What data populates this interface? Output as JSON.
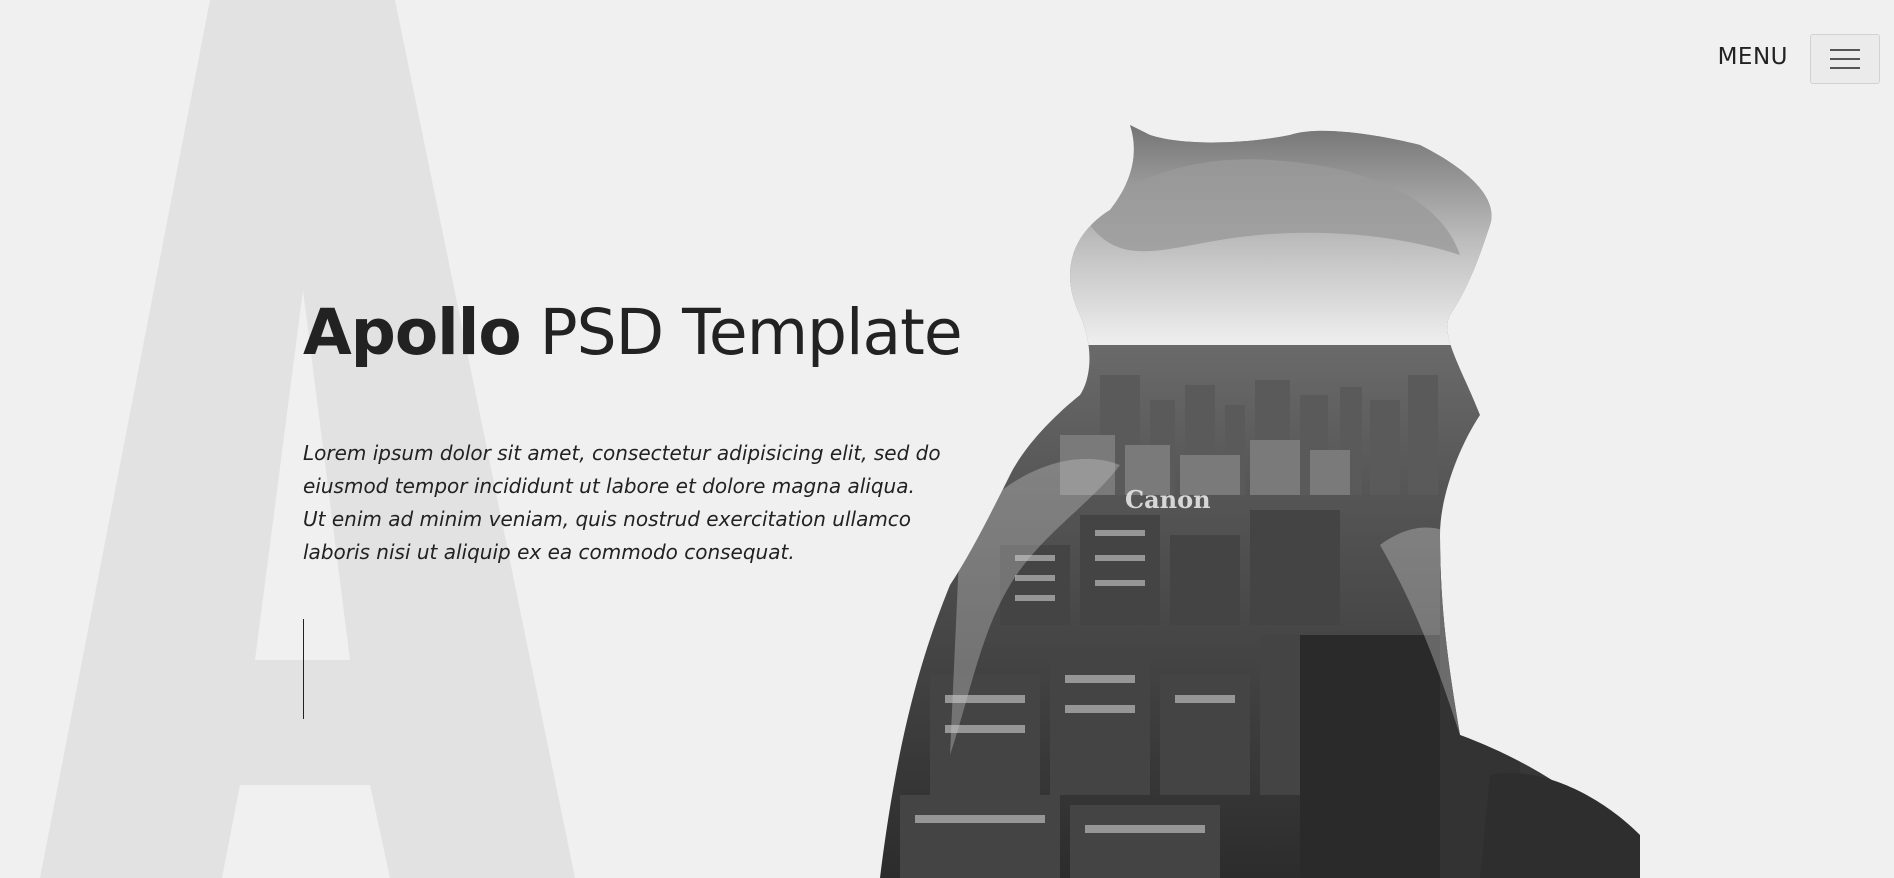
{
  "header": {
    "menu_label": "MENU"
  },
  "hero": {
    "background_letter": "A",
    "title_bold": "Apollo",
    "title_rest": " PSD Template",
    "description": "Lorem ipsum dolor sit amet, consectetur adipisicing elit, sed do eiusmod tempor incididunt ut labore et dolore magna aliqua. Ut enim ad minim veniam, quis nostrud exercitation ullamco laboris nisi ut aliquip ex ea commodo consequat.",
    "image_text": "Canon"
  },
  "icons": {
    "menu_toggle": "hamburger-icon"
  },
  "colors": {
    "background": "#f0f0f0",
    "text": "#222222",
    "letter": "#e2e2e2"
  }
}
